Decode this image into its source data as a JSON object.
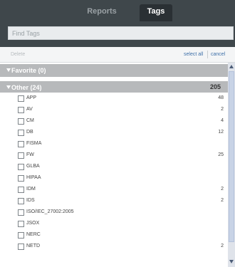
{
  "tabs": [
    {
      "label": "Reports",
      "active": false
    },
    {
      "label": "Tags",
      "active": true
    }
  ],
  "search": {
    "placeholder": "Find Tags",
    "value": ""
  },
  "actions": {
    "delete_label": "Delete",
    "select_all_label": "select all",
    "cancel_label": "cancel"
  },
  "groups": {
    "favorite": {
      "label": "Favorite (0)"
    },
    "other": {
      "label": "Other (24)",
      "count": "205"
    }
  },
  "items": [
    {
      "name": "APP",
      "count": "48"
    },
    {
      "name": "AV",
      "count": "2"
    },
    {
      "name": "CM",
      "count": "4"
    },
    {
      "name": "DB",
      "count": "12"
    },
    {
      "name": "FISMA",
      "count": ""
    },
    {
      "name": "FW",
      "count": "25"
    },
    {
      "name": "GLBA",
      "count": ""
    },
    {
      "name": "HIPAA",
      "count": ""
    },
    {
      "name": "IDM",
      "count": "2"
    },
    {
      "name": "IDS",
      "count": "2"
    },
    {
      "name": "ISO/IEC_27002:2005",
      "count": ""
    },
    {
      "name": "JSOX",
      "count": ""
    },
    {
      "name": "NERC",
      "count": ""
    },
    {
      "name": "NETD",
      "count": "2"
    }
  ],
  "colors": {
    "header_bg": "#3f474b",
    "group_bg": "#b7b9bb",
    "link": "#3d6fa8"
  }
}
